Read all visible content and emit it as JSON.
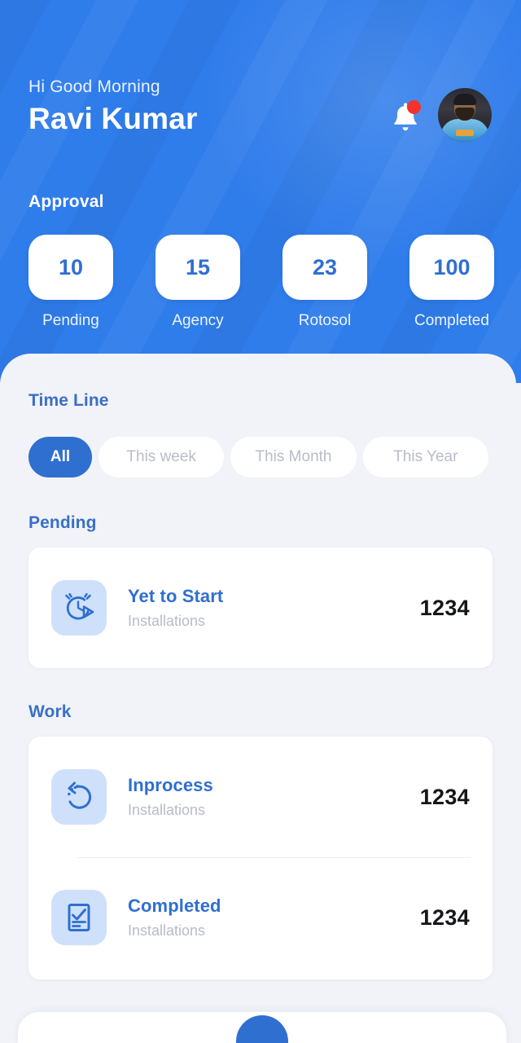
{
  "header": {
    "greeting": "Hi Good Morning",
    "username": "Ravi Kumar",
    "bell_icon": "notification-bell-icon",
    "avatar_alt": "user-avatar",
    "bg_color": "#2f7ceb",
    "approval": {
      "title": "Approval",
      "items": [
        {
          "value": "10",
          "label": "Pending"
        },
        {
          "value": "15",
          "label": "Agency"
        },
        {
          "value": "23",
          "label": "Rotosol"
        },
        {
          "value": "100",
          "label": "Completed"
        }
      ]
    }
  },
  "timeline": {
    "title": "Time Line",
    "filters": [
      {
        "label": "All",
        "active": true
      },
      {
        "label": "This week",
        "active": false
      },
      {
        "label": "This Month",
        "active": false
      },
      {
        "label": "This Year",
        "active": false
      }
    ]
  },
  "sections": [
    {
      "title": "Pending",
      "rows": [
        {
          "title": "Yet to Start",
          "subtitle": "Installations",
          "count": "1234",
          "icon": "alarm-clock-play-icon"
        }
      ]
    },
    {
      "title": "Work",
      "rows": [
        {
          "title": "Inprocess",
          "subtitle": "Installations",
          "count": "1234",
          "icon": "circular-arrow-refresh-icon"
        },
        {
          "title": "Completed",
          "subtitle": "Installations",
          "count": "1234",
          "icon": "document-check-icon"
        }
      ]
    }
  ],
  "bottom_bar": {
    "fab_icon": "add-button-icon"
  },
  "colors": {
    "primary": "#2f6fd0",
    "header": "#2f7ceb",
    "background": "#f1f3f8",
    "card": "#ffffff",
    "icon_tile": "#cfe0fb",
    "muted_text": "#b8bcc6",
    "count_text": "#15161a",
    "badge": "#f5332c"
  }
}
